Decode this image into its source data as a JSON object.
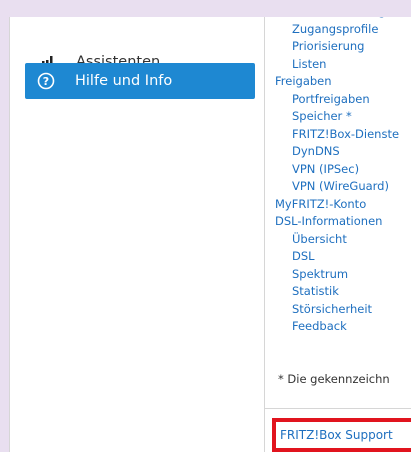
{
  "sidebar": {
    "items": [
      {
        "label": "Assistenten",
        "icon": "wand-signal-icon",
        "active": false
      },
      {
        "label": "Hilfe und Info",
        "icon": "question-circle-icon",
        "active": true
      }
    ],
    "active_color": "#1e88d2"
  },
  "content": {
    "tree": [
      {
        "label": "Kindersicherung",
        "level": 2
      },
      {
        "label": "Zugangsprofile",
        "level": 2
      },
      {
        "label": "Priorisierung",
        "level": 2
      },
      {
        "label": "Listen",
        "level": 2
      },
      {
        "label": "Freigaben",
        "level": 1
      },
      {
        "label": "Portfreigaben",
        "level": 2
      },
      {
        "label": "Speicher *",
        "level": 2
      },
      {
        "label": "FRITZ!Box-Dienste",
        "level": 2
      },
      {
        "label": "DynDNS",
        "level": 2
      },
      {
        "label": "VPN (IPSec)",
        "level": 2
      },
      {
        "label": "VPN (WireGuard)",
        "level": 2
      },
      {
        "label": "MyFRITZ!-Konto",
        "level": 1
      },
      {
        "label": "DSL-Informationen",
        "level": 1
      },
      {
        "label": "Übersicht",
        "level": 2
      },
      {
        "label": "DSL",
        "level": 2
      },
      {
        "label": "Spektrum",
        "level": 2
      },
      {
        "label": "Statistik",
        "level": 2
      },
      {
        "label": "Störsicherheit",
        "level": 2
      },
      {
        "label": "Feedback",
        "level": 2
      }
    ],
    "footnote": "*  Die gekennzeichn",
    "support_link": "FRITZ!Box Support",
    "link_color": "#1e6fbf",
    "highlight_color": "#e1141e"
  }
}
